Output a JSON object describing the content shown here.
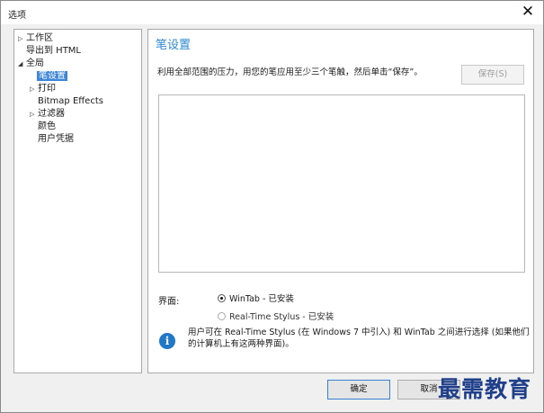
{
  "window": {
    "title": "选项",
    "close_glyph": "✕"
  },
  "tree": {
    "items": [
      {
        "label": "工作区",
        "caret": "▷"
      },
      {
        "label": "导出到 HTML",
        "caret": ""
      },
      {
        "label": "全局",
        "caret": "◢"
      },
      {
        "label": "笔设置",
        "caret": "",
        "selected": true
      },
      {
        "label": "打印",
        "caret": "▷"
      },
      {
        "label": "Bitmap Effects",
        "caret": ""
      },
      {
        "label": "过滤器",
        "caret": "▷"
      },
      {
        "label": "颜色",
        "caret": ""
      },
      {
        "label": "用户凭据",
        "caret": ""
      }
    ]
  },
  "panel": {
    "title": "笔设置",
    "description": "利用全部范围的压力，用您的笔应用至少三个笔触，然后单击“保存”。",
    "save_label": "保存(S)",
    "interface_label": "界面:",
    "radios": [
      {
        "label": "WinTab - 已安装",
        "checked": true
      },
      {
        "label": "Real-Time Stylus - 已安装",
        "checked": false
      }
    ],
    "info_icon": "i",
    "info_text": "用户可在 Real-Time Stylus (在 Windows 7 中引入) 和 WinTab 之间进行选择 (如果他们的计算机上有这两种界面)。"
  },
  "footer": {
    "ok_label": "确定",
    "cancel_label": "取消"
  },
  "watermark": {
    "text": "最需教育"
  }
}
